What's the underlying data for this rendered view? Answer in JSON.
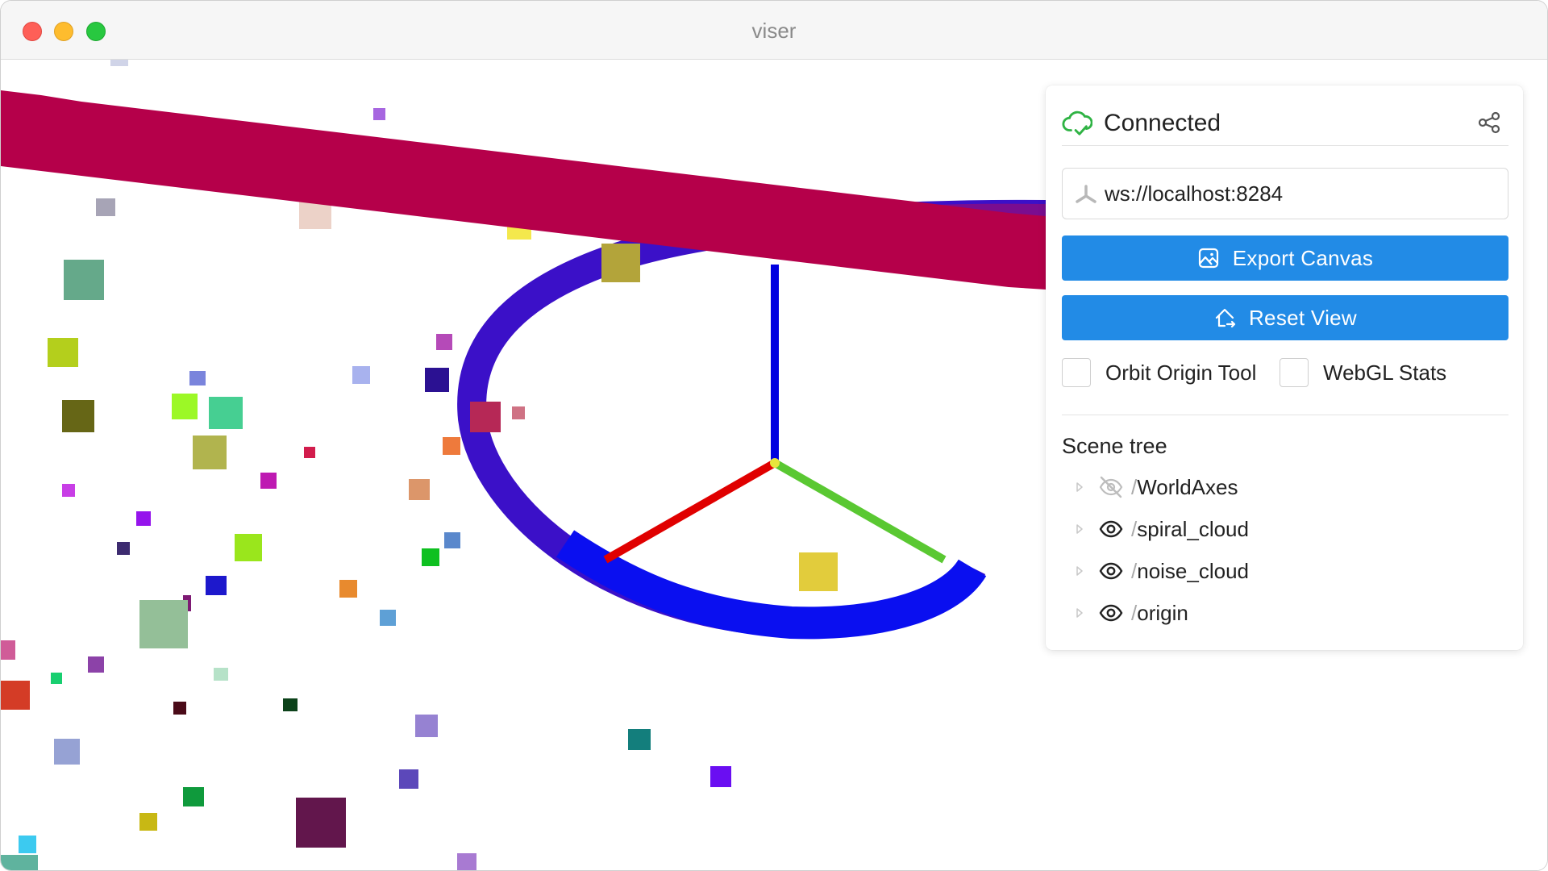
{
  "window": {
    "title": "viser"
  },
  "panel": {
    "status": {
      "label": "Connected",
      "icon": "cloud-check-icon",
      "color": "#2fb344"
    },
    "server": {
      "url": "ws://localhost:8284",
      "icon": "viser-logo-icon"
    },
    "buttons": {
      "export": {
        "label": "Export Canvas",
        "icon": "photo-icon"
      },
      "reset": {
        "label": "Reset View",
        "icon": "home-move-icon"
      }
    },
    "checkboxes": [
      {
        "label": "Orbit Origin Tool",
        "checked": false
      },
      {
        "label": "WebGL Stats",
        "checked": false
      }
    ],
    "scene_tree": {
      "title": "Scene tree",
      "items": [
        {
          "name": "WorldAxes",
          "visible": false
        },
        {
          "name": "spiral_cloud",
          "visible": true
        },
        {
          "name": "noise_cloud",
          "visible": true
        },
        {
          "name": "origin",
          "visible": true
        }
      ]
    }
  },
  "colors": {
    "accent": "#228be6",
    "axis_x": "#e00000",
    "axis_y": "#5ac832",
    "axis_z": "#0000e0",
    "band": "#b5004a",
    "ring": "#1a10e0"
  }
}
